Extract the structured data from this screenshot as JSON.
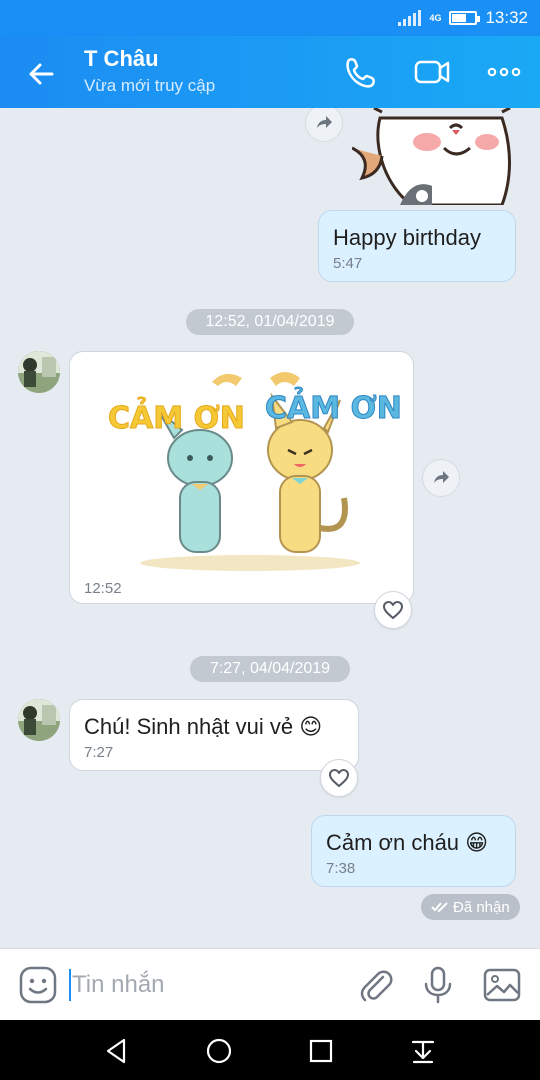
{
  "status_bar": {
    "time": "13:32",
    "network": "4G",
    "battery_level": 0.6
  },
  "header": {
    "title": "T Châu",
    "subtitle": "Vừa mới truy cập"
  },
  "messages": [
    {
      "side": "me",
      "text": "Happy birthday",
      "time": "5:47"
    },
    {
      "date_separator": "12:52, 01/04/2019"
    },
    {
      "side": "other",
      "type": "sticker",
      "sticker_text_left": "CẢM ƠN",
      "sticker_text_right": "CẢM ƠN",
      "time": "12:52"
    },
    {
      "date_separator": "7:27, 04/04/2019"
    },
    {
      "side": "other",
      "text": "Chú!  Sinh nhật vui vẻ 😊",
      "time": "7:27"
    },
    {
      "side": "me",
      "text": "Cảm ơn cháu 😁",
      "time": "7:38",
      "status": "Đã nhận"
    }
  ],
  "input": {
    "placeholder": "Tin nhắn"
  },
  "colors": {
    "accent": "#1a8ff5",
    "bubble_me": "#dcf1ff",
    "bubble_other": "#ffffff",
    "background": "#e6eaf1"
  }
}
